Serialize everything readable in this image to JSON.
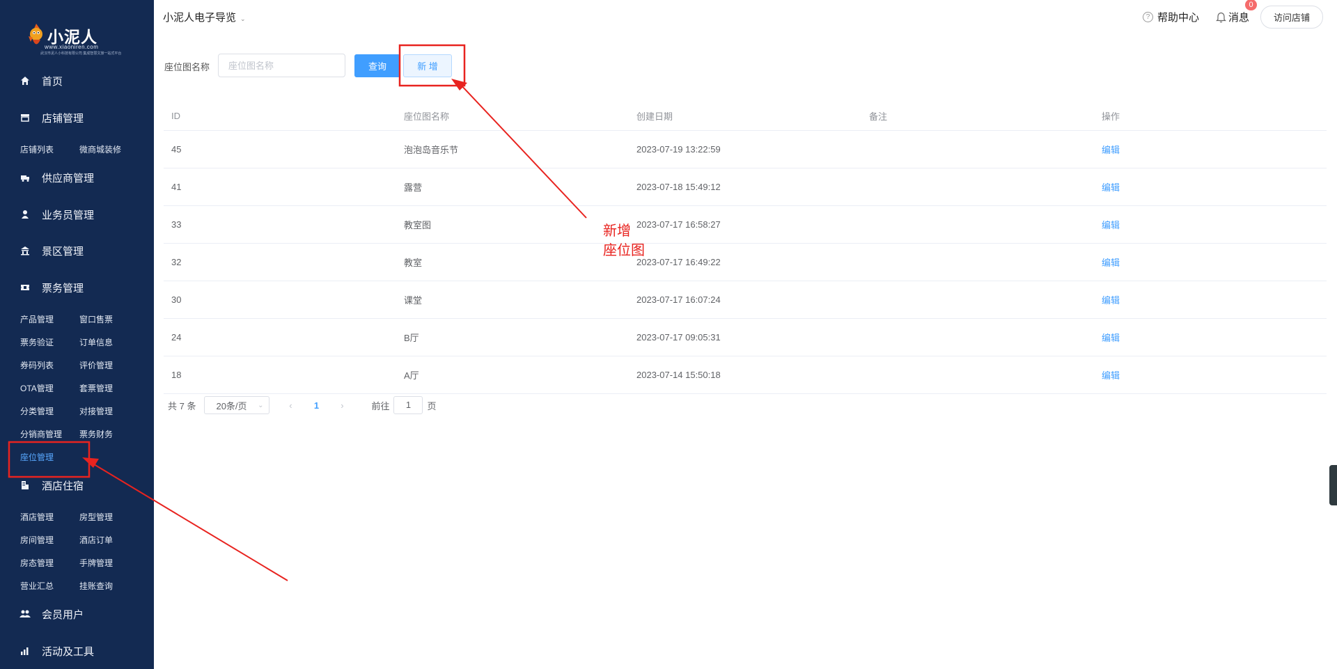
{
  "sidebar": {
    "logo": {
      "brand": "小泥人",
      "url": "www.xiaoniren.com",
      "slogan": "武汉市泥人小科技有限公司 集成智慧文旅一站式平台"
    },
    "groups": [
      {
        "label": "首页",
        "icon": "home-icon"
      },
      {
        "label": "店铺管理",
        "icon": "store-icon",
        "subs": [
          "店铺列表",
          "微商城装修"
        ]
      },
      {
        "label": "供应商管理",
        "icon": "truck-icon"
      },
      {
        "label": "业务员管理",
        "icon": "user-icon"
      },
      {
        "label": "景区管理",
        "icon": "building-icon"
      },
      {
        "label": "票务管理",
        "icon": "ticket-icon",
        "subs": [
          "产品管理",
          "窗口售票",
          "票务验证",
          "订单信息",
          "券码列表",
          "评价管理",
          "OTA管理",
          "套票管理",
          "分类管理",
          "对接管理",
          "分销商管理",
          "票务财务",
          "座位管理"
        ]
      },
      {
        "label": "酒店住宿",
        "icon": "hotel-icon",
        "subs": [
          "酒店管理",
          "房型管理",
          "房间管理",
          "酒店订单",
          "房态管理",
          "手牌管理",
          "营业汇总",
          "挂账查询"
        ]
      },
      {
        "label": "会员用户",
        "icon": "members-icon"
      },
      {
        "label": "活动及工具",
        "icon": "chart-icon"
      }
    ]
  },
  "header": {
    "title": "小泥人电子导览",
    "help": "帮助中心",
    "messages": "消息",
    "badge": "0",
    "visit": "访问店铺"
  },
  "search": {
    "label": "座位图名称",
    "placeholder": "座位图名称",
    "query": "查询",
    "add": "新 增"
  },
  "table": {
    "columns": [
      "ID",
      "座位图名称",
      "创建日期",
      "备注",
      "操作"
    ],
    "action_label": "编辑",
    "rows": [
      {
        "id": "45",
        "name": "泡泡岛音乐节",
        "date": "2023-07-19 13:22:59",
        "note": ""
      },
      {
        "id": "41",
        "name": "露营",
        "date": "2023-07-18 15:49:12",
        "note": ""
      },
      {
        "id": "33",
        "name": "教室图",
        "date": "2023-07-17 16:58:27",
        "note": ""
      },
      {
        "id": "32",
        "name": "教室",
        "date": "2023-07-17 16:49:22",
        "note": ""
      },
      {
        "id": "30",
        "name": "课堂",
        "date": "2023-07-17 16:07:24",
        "note": ""
      },
      {
        "id": "24",
        "name": "B厅",
        "date": "2023-07-17 09:05:31",
        "note": ""
      },
      {
        "id": "18",
        "name": "A厅",
        "date": "2023-07-14 15:50:18",
        "note": ""
      }
    ]
  },
  "pagination": {
    "total": "共 7 条",
    "page_size": "20条/页",
    "current_page": "1",
    "goto_label": "前往",
    "goto_value": "1",
    "page_unit": "页"
  },
  "annotation": {
    "line1": "新增",
    "line2": "座位图",
    "color": "#e8231f"
  }
}
